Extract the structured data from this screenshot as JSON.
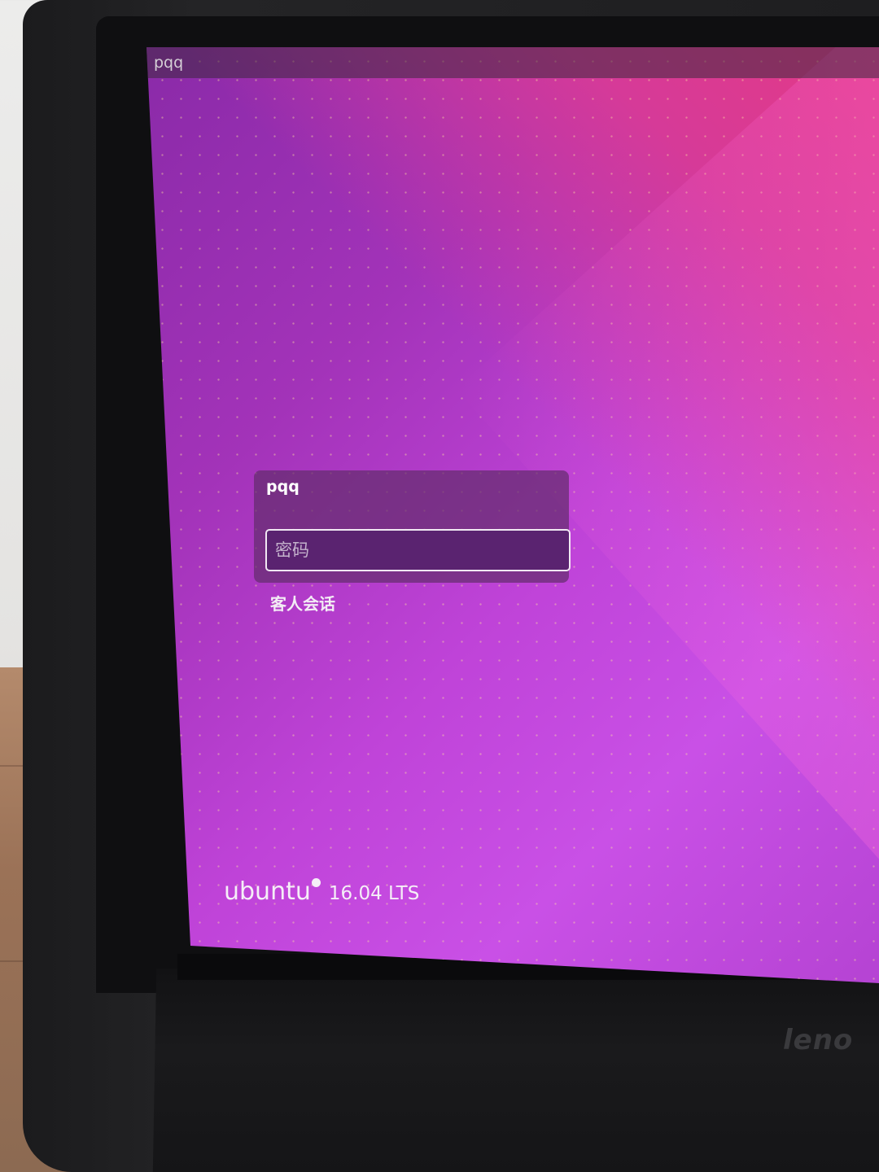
{
  "topbar": {
    "hostname": "pqq"
  },
  "login": {
    "username": "pqq",
    "password_placeholder": "密码",
    "guest_session": "客人会话"
  },
  "branding": {
    "name": "ubuntu",
    "version": "16.04 LTS"
  },
  "monitor": {
    "brand": "leno"
  },
  "colors": {
    "accent": "#a333b9",
    "panel": "#642d6e",
    "field": "#5a2370"
  }
}
